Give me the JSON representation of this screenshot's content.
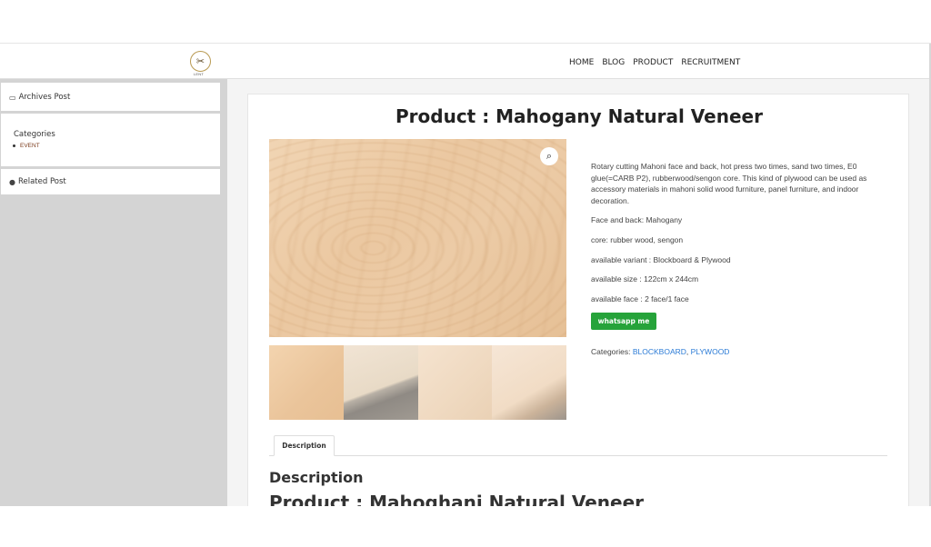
{
  "header": {
    "logo_glyph": "✂",
    "logo_text": "LENT",
    "nav": [
      "HOME",
      "BLOG",
      "PRODUCT",
      "RECRUITMENT"
    ]
  },
  "sidebar": {
    "archives_title": "Archives Post",
    "categories_title": "Categories",
    "categories": [
      "EVENT"
    ],
    "related_title": "Related Post"
  },
  "product": {
    "title": "Product : Mahogany Natural Veneer",
    "description_lines": [
      "Rotary cutting Mahoni face and back, hot press two times, sand two times, E0 glue(=CARB P2),  rubberwood/sengon core. This kind of plywood can be used as accessory materials in mahoni solid wood furniture, panel furniture, and indoor decoration.",
      "Face and back: Mahogany",
      "core: rubber wood, sengon",
      "available variant : Blockboard & Plywood",
      "available size : 122cm x 244cm",
      "available face : 2 face/1 face"
    ],
    "whatsapp_label": "whatsapp me",
    "categories_label": "Categories: ",
    "category_links": [
      "BLOCKBOARD",
      "PLYWOOD"
    ],
    "category_separator": ", ",
    "tab_label": "Description",
    "section_heading": "Description",
    "section_title": "Product : Mahoghani Natural Veneer",
    "zoom_icon": "search-icon"
  },
  "colors": {
    "whatsapp": "#26a33a",
    "link": "#2b7bd6",
    "sidebar_bg": "#d4d4d4"
  }
}
